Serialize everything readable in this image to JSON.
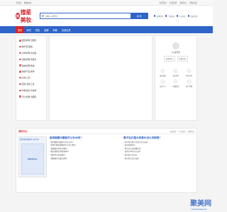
{
  "topbar": {
    "left": [
      "手机版",
      "收藏本站"
    ],
    "right": [
      "免费登录",
      "免费注册",
      "客服中心",
      "网站导航"
    ]
  },
  "logo": {
    "mark": "搜",
    "text": "搜星美妆",
    "sub": "www.sxmz.com"
  },
  "search": {
    "placeholder": "请输入关键词",
    "button": "搜 索"
  },
  "features": [
    "品牌检测",
    "厂家直销",
    "产品供应",
    "招商代理"
  ],
  "nav": [
    "首页",
    "资讯",
    "供应",
    "品牌",
    "商城",
    "全部目录"
  ],
  "sidebar": [
    "面部护理 洁面乳",
    "精华液 眼霜",
    "身体护理 沐浴露",
    "美发护理 洗发水",
    "美容护理 精油",
    "美容产品 美体",
    "彩妆 口红",
    "卸妆 化妆工具",
    "护肤套装 化妆棉",
    "男士护理 洁面乳"
  ],
  "user": {
    "greeting": "Hi,请登录",
    "buttons": [
      "免费登录",
      "免费注册"
    ],
    "icons": [
      "商品管理",
      "发布供应",
      "我的订单",
      "会员中心",
      "收藏商品",
      "客户管理"
    ]
  },
  "news": {
    "title": "资讯中心",
    "tabs": [
      "美容资讯",
      "行业资讯",
      "品牌资讯"
    ],
    "thumb_caption": "医用面膜冷敷贴可以补水吗?",
    "thumb_label": "MEDICAL",
    "col1": {
      "title": "医用面膜冷敷贴可以补水吗?",
      "items": [
        "医用面膜冷敷贴可以补水吗?",
        "医用冷敷贴面膜是什么可以用吗",
        "敷面膜的好处有哪些",
        "敷完面膜后需要洗脸吗",
        "面膜可以天天敷吗",
        "面膜敷多久最合适呢"
      ]
    },
    "col2": {
      "title": "鼻子毛孔粗大有黑头怎么去除呢?",
      "items": [
        "鼻子毛孔粗大有黑头怎么去除",
        "如何收缩毛孔",
        "黑头怎么去除最有效",
        "去黑头用什么方法好",
        "毛孔粗大怎么办",
        "鼻头黑头怎么去掉"
      ]
    }
  },
  "watermark": {
    "text": "聚美网",
    "sub": "www.jumeiwang.com"
  }
}
